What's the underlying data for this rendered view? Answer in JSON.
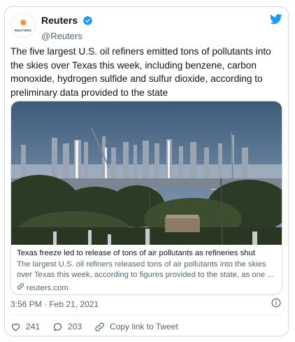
{
  "author": {
    "display_name": "Reuters",
    "handle": "@Reuters",
    "avatar_label": "REUTERS"
  },
  "tweet": {
    "text": "The five largest U.S. oil refiners emitted tons of pollutants into the skies over Texas this week, including benzene, carbon monoxide, hydrogen sulfide and sulfur dioxide, according to preliminary data provided to the state",
    "timestamp": "3:56 PM · Feb 21, 2021"
  },
  "card": {
    "title": "Texas freeze led to release of tons of air pollutants as refineries shut",
    "description": "The largest U.S. oil refiners released tons of air pollutants into the skies over Texas this week, according to figures provided to the state, as one ...",
    "domain": "reuters.com"
  },
  "actions": {
    "likes": "241",
    "replies": "203",
    "copy_link": "Copy link to Tweet"
  },
  "colors": {
    "twitter_blue": "#1d9bf0",
    "like_red": "#f91880",
    "reuters_orange": "#f58220",
    "muted_text": "#536471"
  },
  "icons": [
    "twitter-bird-icon",
    "verified-badge-icon",
    "info-icon",
    "heart-icon",
    "reply-icon",
    "link-icon"
  ]
}
